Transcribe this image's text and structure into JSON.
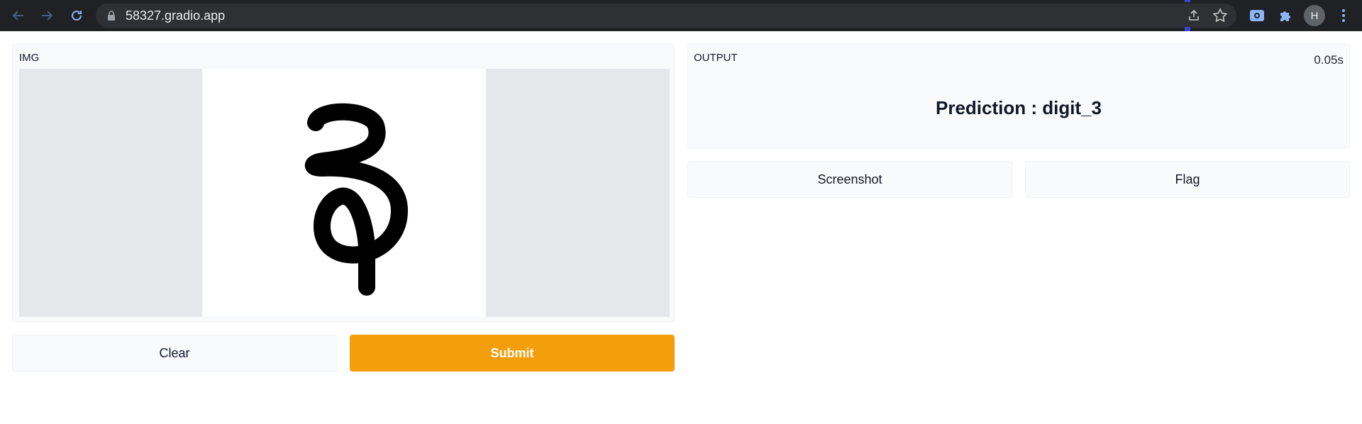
{
  "browser": {
    "url": "58327.gradio.app",
    "profile_initial": "H",
    "icons": [
      "back-icon",
      "forward-icon",
      "reload-icon",
      "lock-icon",
      "share-icon",
      "bookmark-star-icon",
      "screenshot-extension-icon",
      "extensions-puzzle-icon",
      "menu-dots-icon"
    ]
  },
  "input": {
    "label": "IMG",
    "canvas_drawing": "handwritten digit 3"
  },
  "output": {
    "label": "OUTPUT",
    "time": "0.05s",
    "prediction": "Prediction : digit_3"
  },
  "buttons": {
    "clear": "Clear",
    "submit": "Submit",
    "screenshot": "Screenshot",
    "flag": "Flag"
  },
  "colors": {
    "submit_bg": "#f59e0b",
    "chrome_bg": "#202124"
  }
}
